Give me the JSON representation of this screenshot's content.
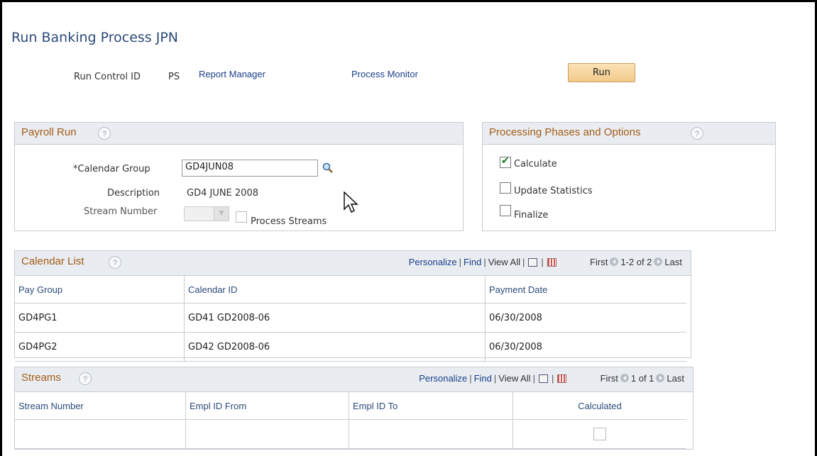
{
  "page": {
    "title": "Run Banking Process JPN"
  },
  "header": {
    "run_control_label": "Run Control ID",
    "run_control_value": "PS",
    "report_manager": "Report Manager",
    "process_monitor": "Process Monitor",
    "run_button": "Run"
  },
  "payroll_run": {
    "heading": "Payroll Run",
    "calendar_group_label": "*Calendar Group",
    "calendar_group_value": "GD4JUN08",
    "description_label": "Description",
    "description_value": "GD4 JUNE 2008",
    "stream_number_label": "Stream Number",
    "process_streams_label": "Process Streams"
  },
  "phases": {
    "heading": "Processing Phases and Options",
    "options": [
      {
        "label": "Calculate",
        "checked": true
      },
      {
        "label": "Update Statistics",
        "checked": false
      },
      {
        "label": "Finalize",
        "checked": false
      }
    ]
  },
  "calendar_list": {
    "heading": "Calendar List",
    "personalize": "Personalize",
    "find": "Find",
    "view_all": "View All",
    "first": "First",
    "range": "1-2 of 2",
    "last": "Last",
    "columns": [
      "Pay Group",
      "Calendar ID",
      "Payment Date"
    ],
    "rows": [
      [
        "GD4PG1",
        "GD41 GD2008-06",
        "06/30/2008"
      ],
      [
        "GD4PG2",
        "GD42 GD2008-06",
        "06/30/2008"
      ]
    ]
  },
  "streams": {
    "heading": "Streams",
    "personalize": "Personalize",
    "find": "Find",
    "view_all": "View All",
    "first": "First",
    "range": "1 of 1",
    "last": "Last",
    "columns": [
      "Stream Number",
      "Empl ID From",
      "Empl ID To",
      "Calculated"
    ]
  },
  "icons": {
    "help": "help-icon",
    "lookup": "magnifier-icon",
    "zoom": "zoom-icon",
    "download": "download-grid-icon"
  }
}
